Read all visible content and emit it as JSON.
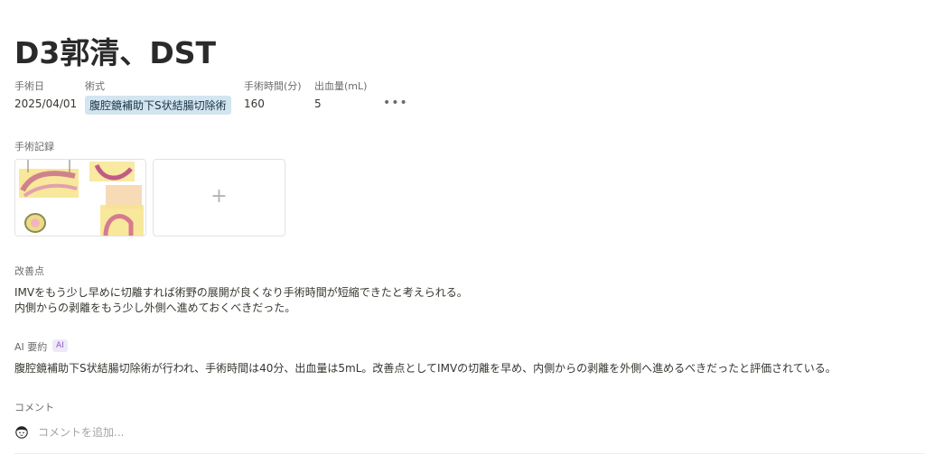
{
  "page": {
    "title": "D3郭清、DST"
  },
  "properties": {
    "date": {
      "label": "手術日",
      "value": "2025/04/01"
    },
    "procedure": {
      "label": "術式",
      "value": "腹腔鏡補助下S状結腸切除術"
    },
    "duration": {
      "label": "手術時間(分)",
      "value": "160"
    },
    "blood_loss": {
      "label": "出血量(mL)",
      "value": "5"
    },
    "more_icon": "more-horizontal-icon",
    "tag_color": "#d3e5ef"
  },
  "record": {
    "label": "手術記録",
    "add_icon": "plus-icon",
    "add_symbol": "+"
  },
  "improvements": {
    "label": "改善点",
    "lines": [
      "IMVをもう少し早めに切離すれば術野の展開が良くなり手術時間が短縮できたと考えられる。",
      "内側からの剥離をもう少し外側へ進めておくべきだった。"
    ]
  },
  "ai_summary": {
    "label": "AI 要約",
    "badge": "AI",
    "text": "腹腔鏡補助下S状結腸切除術が行われ、手術時間は40分、出血量は5mL。改善点としてIMVの切離を早め、内側からの剥離を外側へ進めるべきだったと評価されている。"
  },
  "comments": {
    "label": "コメント",
    "placeholder": "コメントを追加...",
    "avatar_icon": "user-avatar-icon"
  }
}
